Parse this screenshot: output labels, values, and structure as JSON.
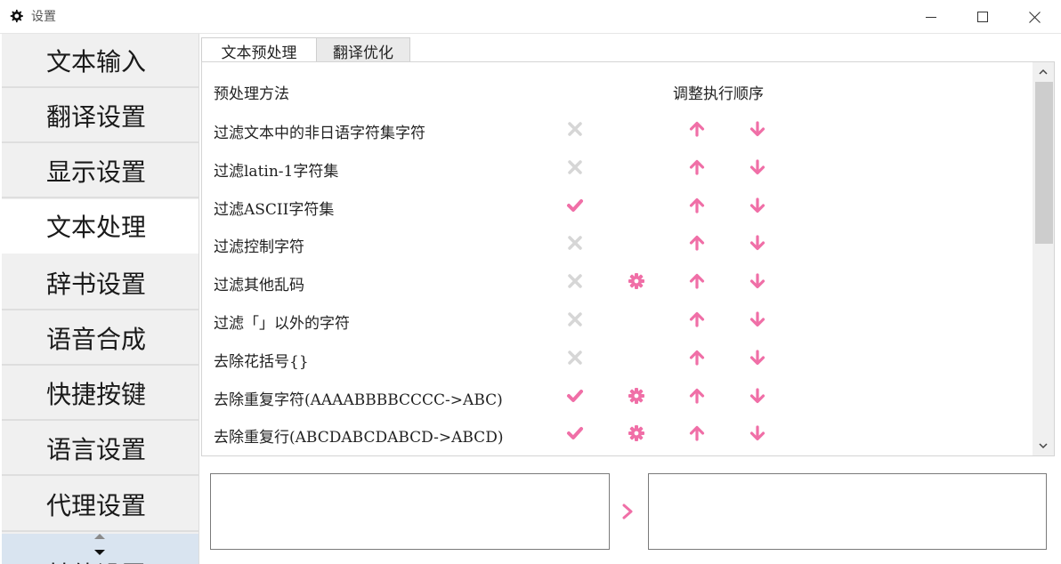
{
  "window": {
    "title": "设置",
    "icon": "gear-icon"
  },
  "sidebar": {
    "items": [
      {
        "label": "文本输入",
        "active": false
      },
      {
        "label": "翻译设置",
        "active": false
      },
      {
        "label": "显示设置",
        "active": false
      },
      {
        "label": "文本处理",
        "active": true
      },
      {
        "label": "辞书设置",
        "active": false
      },
      {
        "label": "语音合成",
        "active": false
      },
      {
        "label": "快捷按键",
        "active": false
      },
      {
        "label": "语言设置",
        "active": false
      },
      {
        "label": "代理设置",
        "active": false
      },
      {
        "label": "其他设置",
        "active": false
      }
    ]
  },
  "tabs": [
    {
      "label": "文本预处理",
      "active": true
    },
    {
      "label": "翻译优化",
      "active": false
    }
  ],
  "list": {
    "header_method": "预处理方法",
    "header_order": "调整执行顺序",
    "rows": [
      {
        "label": "过滤文本中的非日语字符集字符",
        "enabled": false,
        "has_settings": false
      },
      {
        "label": "过滤latin-1字符集",
        "enabled": false,
        "has_settings": false
      },
      {
        "label": "过滤ASCII字符集",
        "enabled": true,
        "has_settings": false
      },
      {
        "label": "过滤控制字符",
        "enabled": false,
        "has_settings": false
      },
      {
        "label": "过滤其他乱码",
        "enabled": false,
        "has_settings": true
      },
      {
        "label": "过滤「」以外的字符",
        "enabled": false,
        "has_settings": false
      },
      {
        "label": "去除花括号{}",
        "enabled": false,
        "has_settings": false
      },
      {
        "label": "去除重复字符(AAAABBBBCCCC->ABC)",
        "enabled": true,
        "has_settings": true
      },
      {
        "label": "去除重复行(ABCDABCDABCD->ABCD)",
        "enabled": true,
        "has_settings": true
      }
    ]
  },
  "colors": {
    "accent": "#f06fa7",
    "disabled": "#d6d6d6"
  },
  "preview": {
    "input_value": "",
    "output_value": "",
    "arrow_icon": "chevron-right-icon"
  }
}
